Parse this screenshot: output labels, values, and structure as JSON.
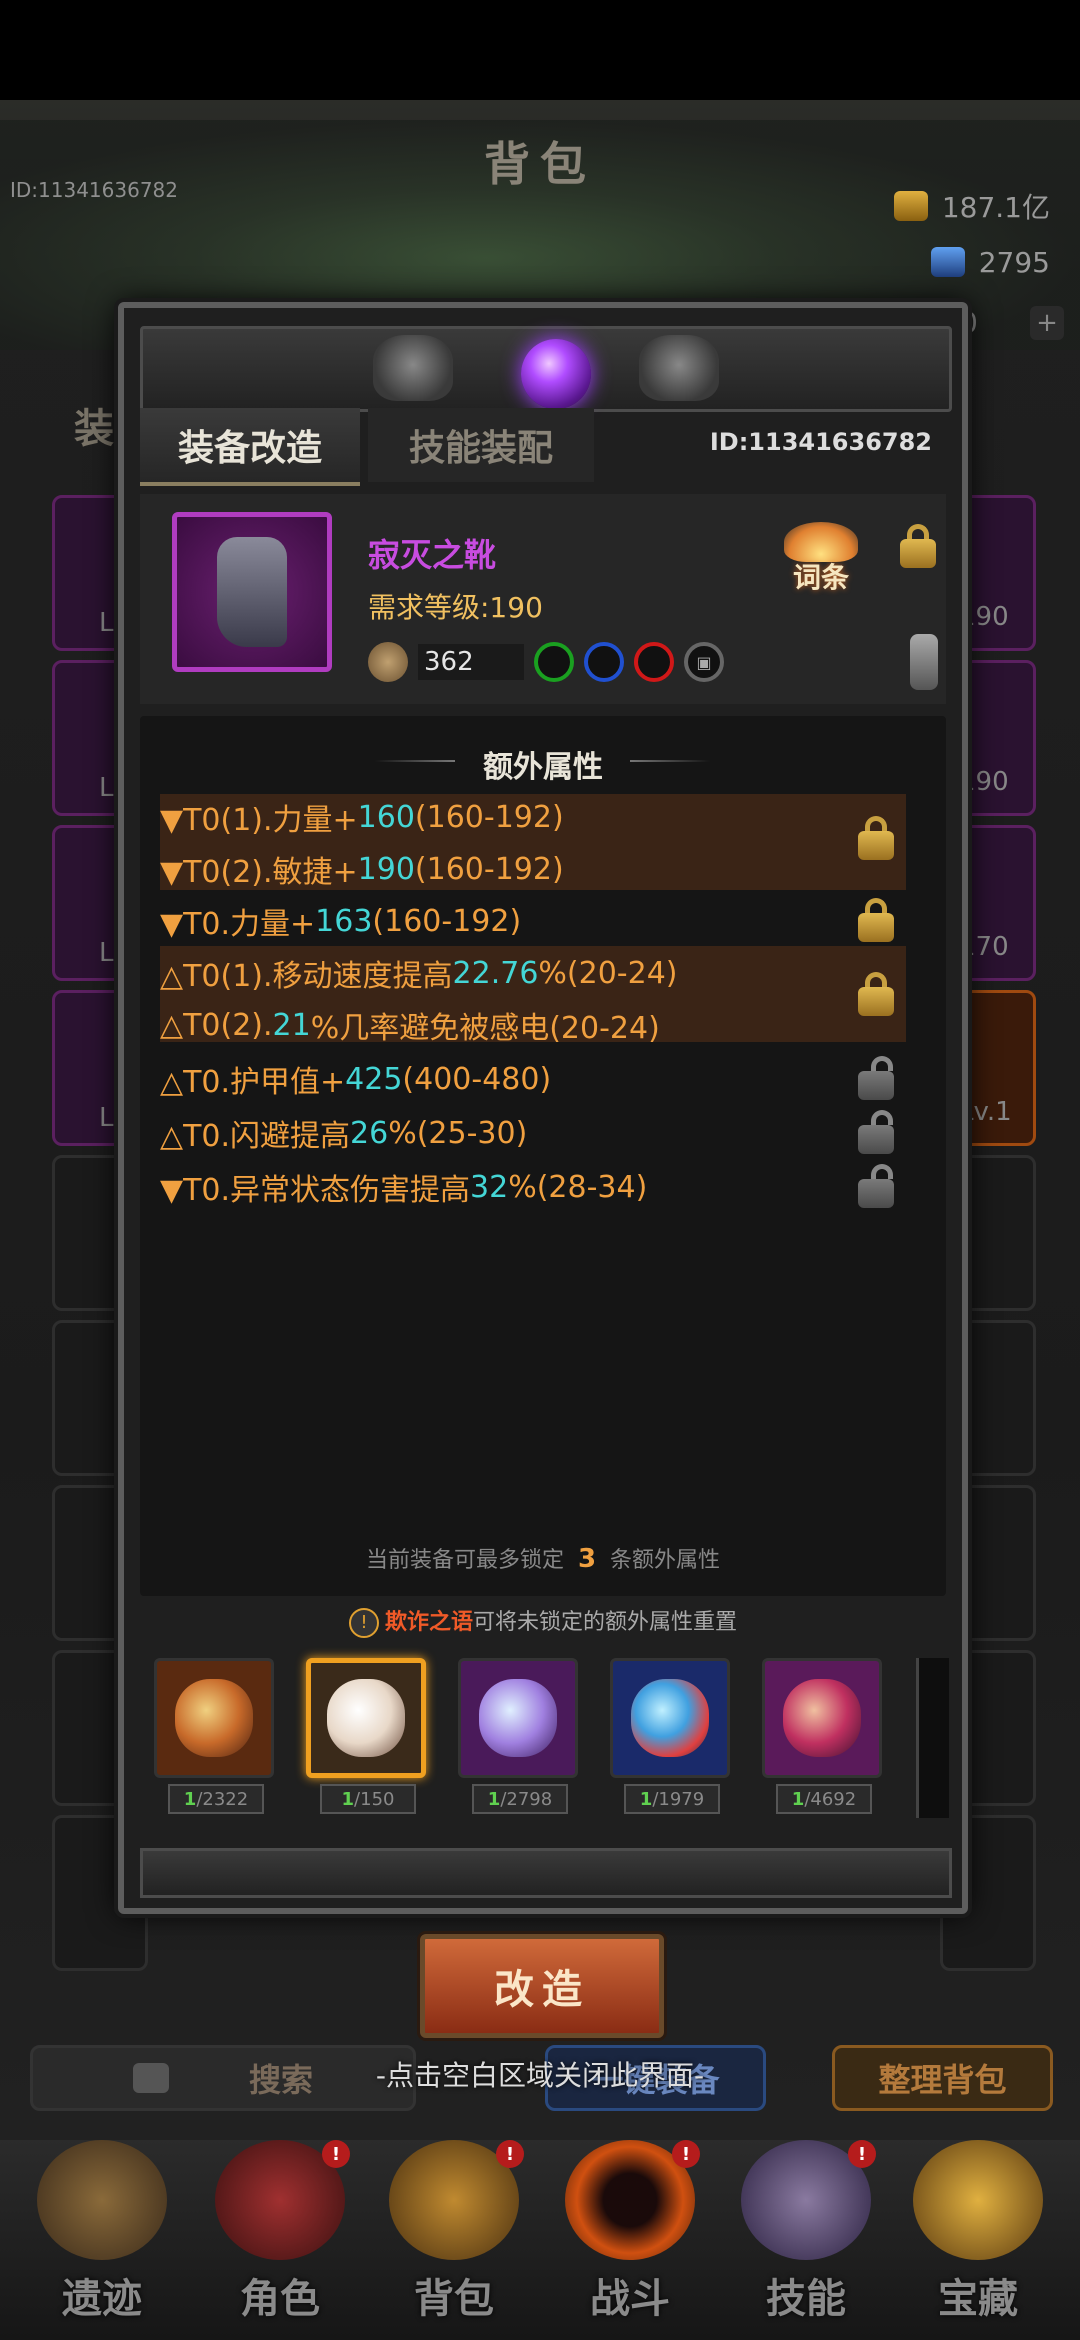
{
  "background": {
    "title": "背包",
    "player_id": "ID:11341636782",
    "gold": "187.1亿",
    "gems": "2795",
    "third_counter": "0",
    "tab_partial": "装",
    "left_slots": [
      "L",
      "L",
      "L",
      "L"
    ],
    "right_slot_levels": [
      "190",
      "190",
      "170",
      "Lv.1"
    ],
    "search_label": "搜索",
    "equip_label": "一键装备",
    "sort_label": "整理背包",
    "nav": [
      {
        "label": "遗迹",
        "badge": ""
      },
      {
        "label": "角色",
        "badge": "!"
      },
      {
        "label": "背包",
        "badge": "!"
      },
      {
        "label": "战斗",
        "badge": "!"
      },
      {
        "label": "技能",
        "badge": "!"
      },
      {
        "label": "宝藏",
        "badge": ""
      }
    ]
  },
  "modal": {
    "tabs": {
      "reforge": "装备改造",
      "skill": "技能装配"
    },
    "id": "ID:11341636782",
    "item": {
      "name": "寂灭之靴",
      "requirement": "需求等级:190",
      "power": "362",
      "sockets": [
        {
          "color": "#1aa020"
        },
        {
          "color": "#2050d0"
        },
        {
          "color": "#d01818"
        },
        {
          "color": "#666666",
          "locked": true
        }
      ],
      "citiao_label": "词条"
    },
    "attr_title": "额外属性",
    "attributes": [
      {
        "prefix": "▼T0(1).力量+",
        "value": "160",
        "suffix": "(160-192)",
        "locked": true
      },
      {
        "prefix": "▼T0(2).敏捷+",
        "value": "190",
        "suffix": "(160-192)",
        "locked": true
      },
      {
        "prefix": "▼T0.力量+",
        "value": "163",
        "suffix": "(160-192)",
        "locked": true
      },
      {
        "prefix": "△T0(1).移动速度提高",
        "value": "22.76",
        "suffix": "%(20-24)",
        "locked": true
      },
      {
        "prefix": "△T0(2).",
        "value": "21",
        "suffix": "%几率避免被感电(20-24)",
        "locked": true
      },
      {
        "prefix": "△T0.护甲值+",
        "value": "425",
        "suffix": "(400-480)",
        "locked": false
      },
      {
        "prefix": "△T0.闪避提高",
        "value": "26",
        "suffix": "%(25-30)",
        "locked": false
      },
      {
        "prefix": "▼T0.异常状态伤害提高",
        "value": "32",
        "suffix": "%(28-34)",
        "locked": false
      }
    ],
    "lock_note": {
      "before": "当前装备可最多锁定",
      "count": "3",
      "after": "条额外属性"
    },
    "material_hint": {
      "warn": "!",
      "name": "欺诈之语",
      "text": "可将未锁定的额外属性重置"
    },
    "materials": [
      {
        "have": "1",
        "total": "/2322",
        "color": "#c86a2a",
        "selected": false
      },
      {
        "have": "1",
        "total": "/150",
        "color": "#e8d8c8",
        "selected": true
      },
      {
        "have": "1",
        "total": "/2798",
        "color": "#a080e0",
        "selected": false
      },
      {
        "have": "1",
        "total": "/1979",
        "color": "#40a0e0",
        "selected": false
      },
      {
        "have": "1",
        "total": "/4692",
        "color": "#c03060",
        "selected": false
      }
    ],
    "reforge_button": "改造",
    "close_hint": "-点击空白区域关闭此界面-"
  }
}
